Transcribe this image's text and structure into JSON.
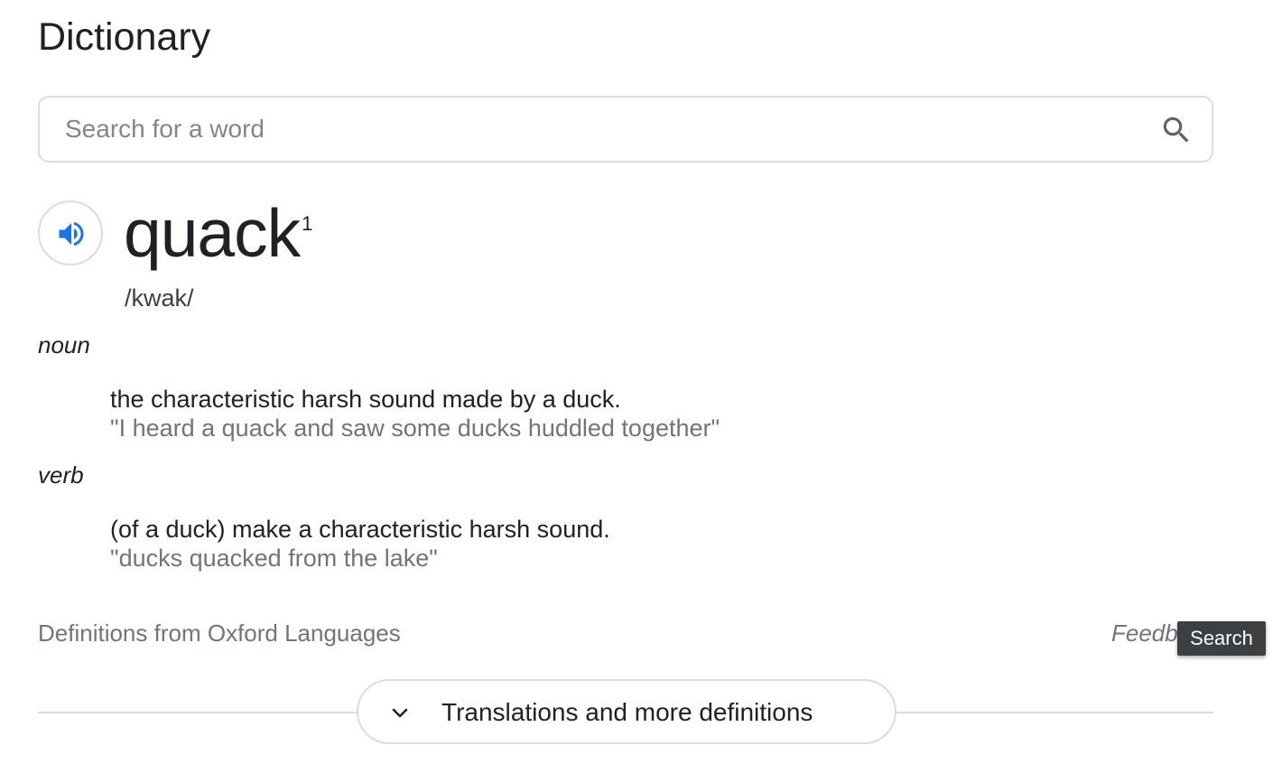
{
  "title": "Dictionary",
  "search": {
    "placeholder": "Search for a word",
    "value": "",
    "icon": "search-icon"
  },
  "entry": {
    "word": "quack",
    "homograph": "1",
    "phonetic": "/kwak/",
    "audio_icon": "speaker-icon",
    "accent_color": "#1a73e8",
    "senses": [
      {
        "pos": "noun",
        "definition": "the characteristic harsh sound made by a duck.",
        "example": "\"I heard a quack and saw some ducks huddled together\""
      },
      {
        "pos": "verb",
        "definition": "(of a duck) make a characteristic harsh sound.",
        "example": "\"ducks quacked from the lake\""
      }
    ]
  },
  "footer": {
    "source": "Definitions from Oxford Languages",
    "feedback": "Feedb",
    "tooltip": "Search"
  },
  "more_button": {
    "label": "Translations and more definitions",
    "icon": "chevron-down-icon"
  }
}
